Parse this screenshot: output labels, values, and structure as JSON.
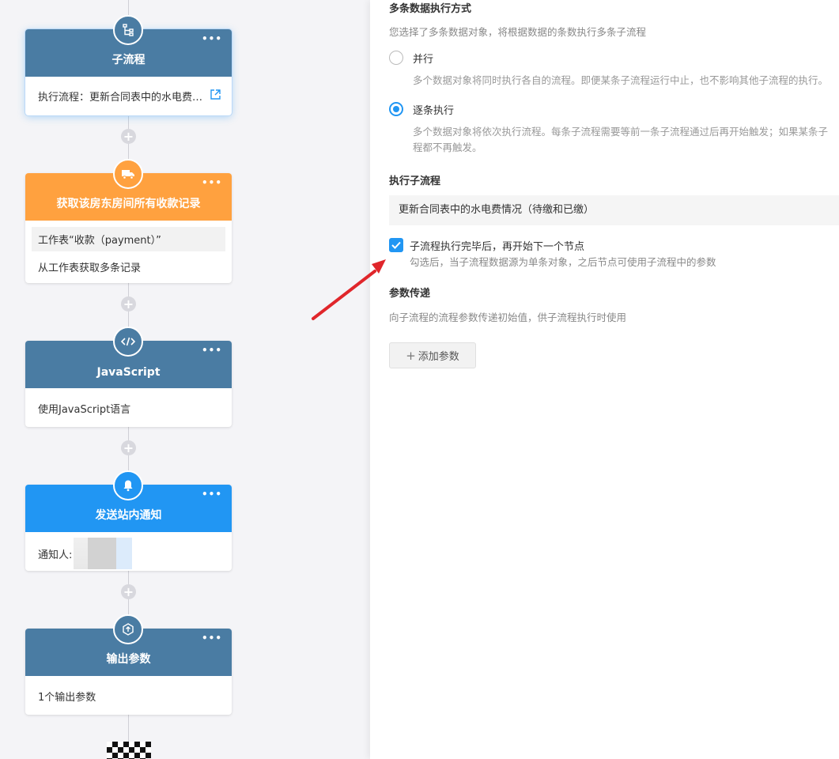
{
  "nodes": {
    "subflow": {
      "title": "子流程",
      "body": "执行流程：更新合同表中的水电费…"
    },
    "fetch": {
      "title": "获取该房东房间所有收款记录",
      "sheet": "工作表“收款（payment）”",
      "desc": "从工作表获取多条记录"
    },
    "js": {
      "title": "JavaScript",
      "body": "使用JavaScript语言"
    },
    "notify": {
      "title": "发送站内通知",
      "label": "通知人:"
    },
    "output": {
      "title": "输出参数",
      "body": "1个输出参数"
    }
  },
  "panel": {
    "multi_mode": {
      "title": "多条数据执行方式",
      "hint": "您选择了多条数据对象，将根据数据的条数执行多条子流程",
      "parallel_label": "并行",
      "parallel_desc": "多个数据对象将同时执行各自的流程。即便某条子流程运行中止，也不影响其他子流程的执行。",
      "sequential_label": "逐条执行",
      "sequential_desc_1": "多个数据对象将依次执行流程。每条子流程需要等前一条子流程通过后再开始触发；如果某条子",
      "sequential_desc_2": "程都不再触发。",
      "selected": "sequential"
    },
    "subflow_section": {
      "title": "执行子流程",
      "flow_name": "更新合同表中的水电费情况（待缴和已缴）",
      "wait_label": "子流程执行完毕后，再开始下一个节点",
      "wait_hint": "勾选后，当子流程数据源为单条对象，之后节点可使用子流程中的参数",
      "wait_checked": true
    },
    "params": {
      "title": "参数传递",
      "hint": "向子流程的流程参数传递初始值，供子流程执行时使用",
      "add_label": "添加参数"
    }
  },
  "colors": {
    "node_blue": "#4a7ca3",
    "node_orange": "#ffa13f",
    "node_bright_blue": "#2196f3",
    "accent": "#2196f3",
    "arrow": "#e0262b"
  }
}
